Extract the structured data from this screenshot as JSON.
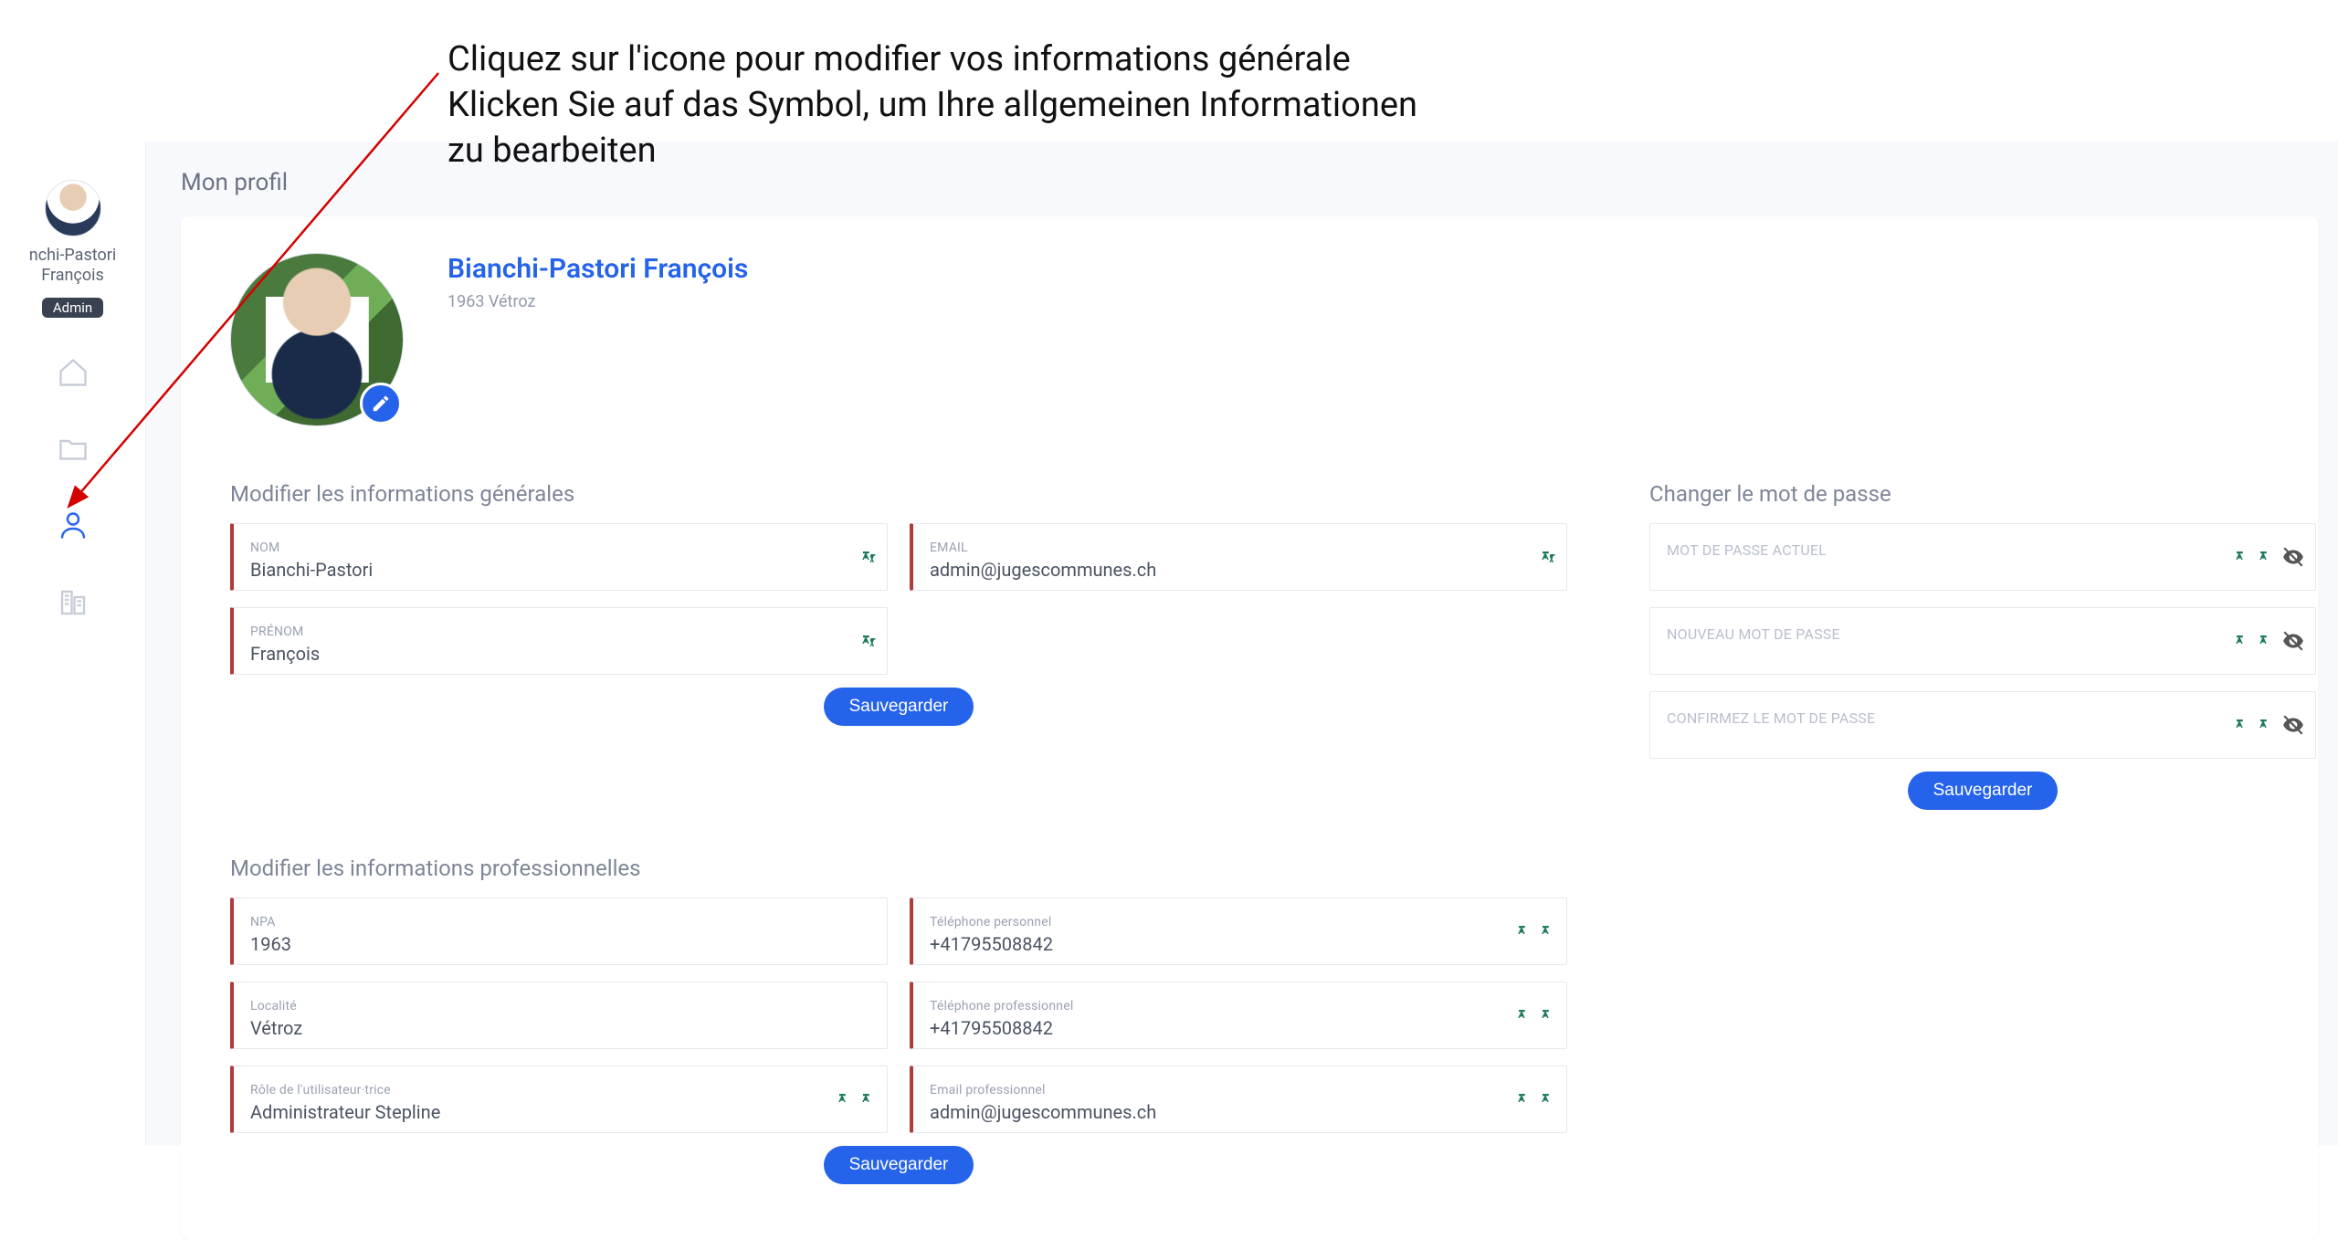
{
  "annotation": {
    "line1": "Cliquez sur l'icone pour modifier vos informations générale",
    "line2": "Klicken Sie auf das Symbol, um Ihre allgemeinen Informationen",
    "line3": "zu bearbeiten"
  },
  "sidebar": {
    "user_name": "nchi-Pastori François",
    "badge": "Admin",
    "nav": {
      "home": "home-icon",
      "folder": "folder-icon",
      "profile": "profile-icon",
      "building": "building-icon"
    }
  },
  "page_title": "Mon profil",
  "profile": {
    "display_name": "Bianchi-Pastori François",
    "subtitle": "1963 Vétroz"
  },
  "sections": {
    "general_title": "Modifier les informations générales",
    "password_title": "Changer le mot de passe",
    "professional_title": "Modifier les informations professionnelles"
  },
  "fields": {
    "nom_label": "NOM",
    "nom_value": "Bianchi-Pastori",
    "email_label": "EMAIL",
    "email_value": "admin@jugescommunes.ch",
    "prenom_label": "PRÉNOM",
    "prenom_value": "François",
    "npa_label": "NPA",
    "npa_value": "1963",
    "tel_perso_label": "Téléphone personnel",
    "tel_perso_value": "+41795508842",
    "localite_label": "Localité",
    "localite_value": "Vétroz",
    "tel_pro_label": "Téléphone professionnel",
    "tel_pro_value": "+41795508842",
    "role_label": "Rôle de l'utilisateur·trice",
    "role_value": "Administrateur Stepline",
    "email_pro_label": "Email professionnel",
    "email_pro_value": "admin@jugescommunes.ch",
    "pw_current_label": "MOT DE PASSE ACTUEL",
    "pw_new_label": "NOUVEAU MOT DE PASSE",
    "pw_confirm_label": "CONFIRMEZ LE MOT DE PASSE"
  },
  "buttons": {
    "save": "Sauvegarder"
  },
  "colors": {
    "primary": "#2563eb",
    "accent_green": "#1f7a5a",
    "field_border": "#b13a3a"
  }
}
